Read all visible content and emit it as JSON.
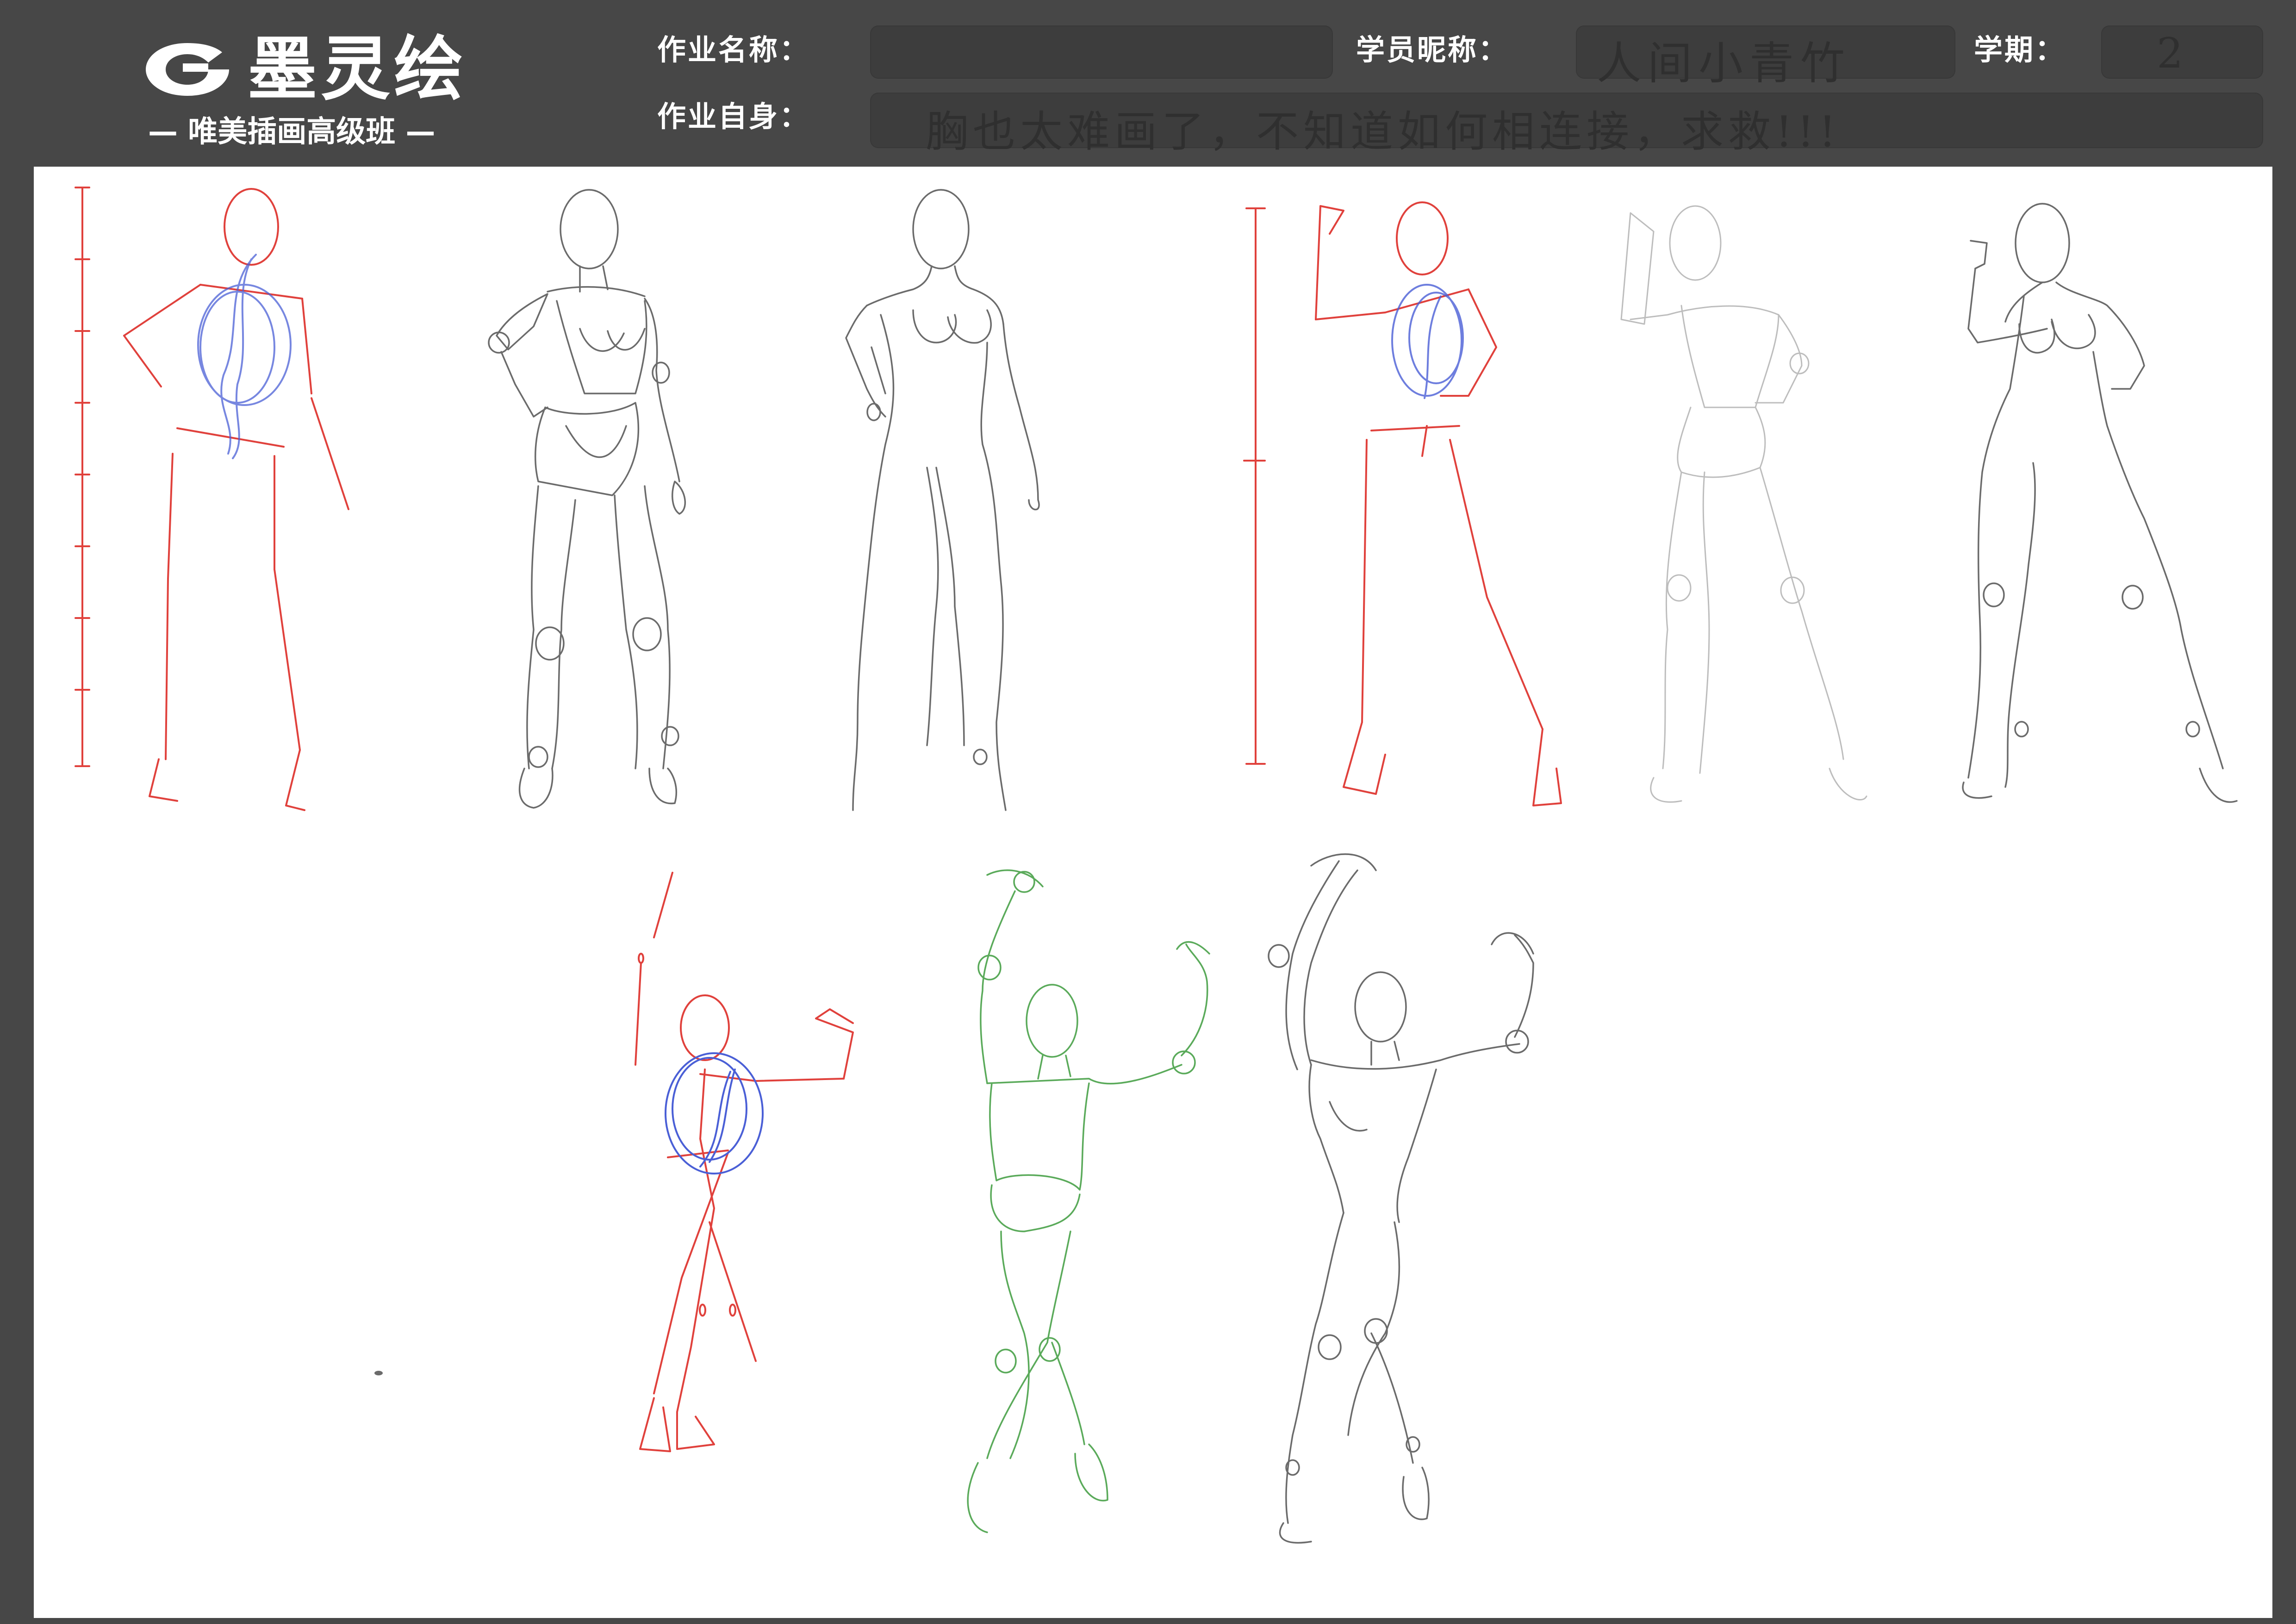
{
  "header": {
    "logo": {
      "icon": "brand-mark-icon",
      "title": "墨灵绘",
      "subtitle": "— 唯美插画高级班 —"
    },
    "assignment_name": {
      "label": "作业名称：",
      "value": ""
    },
    "student_nickname": {
      "label": "学员昵称：",
      "value": "人间小青竹"
    },
    "term": {
      "label": "学期：",
      "value": "2"
    },
    "self_comment": {
      "label": "作业自身：",
      "value": "胸也太难画了，不知道如何相连接，求救!!!"
    }
  },
  "canvas": {
    "background": "#ffffff",
    "frame_color": "#474747",
    "stroke_colors": {
      "construction_red": "#e0413c",
      "torso_blue": "#4a5fd6",
      "mannequin_green": "#5aaa5a",
      "pencil_gray": "#6b6b6b"
    }
  }
}
